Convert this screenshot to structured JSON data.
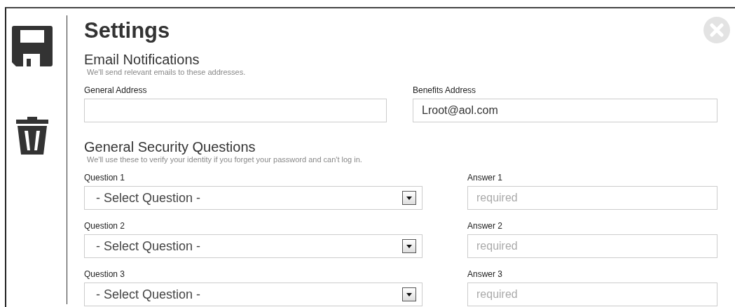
{
  "title": "Settings",
  "sections": [
    {
      "heading": "Email Notifications",
      "subtitle": "We'll send relevant emails to these addresses.",
      "kind": "email",
      "fields": [
        {
          "label": "General Address"
        },
        {
          "label": "Benefits Address",
          "value": "Lroot@aol.com"
        }
      ]
    },
    {
      "heading": "General Security Questions",
      "subtitle": "We'll use these to verify your identity if you forget your password and can't log in.",
      "kind": "questions",
      "rows": [
        {
          "question_label": "Question 1",
          "question_value": "- Select Question -",
          "answer_label": "Answer 1",
          "answer_placeholder": "required"
        },
        {
          "question_label": "Question 2",
          "question_value": "- Select Question -",
          "answer_label": "Answer 2",
          "answer_placeholder": "required"
        },
        {
          "question_label": "Question 3",
          "question_value": "- Select Question -",
          "answer_label": "Answer 3",
          "answer_placeholder": "required"
        }
      ]
    }
  ]
}
